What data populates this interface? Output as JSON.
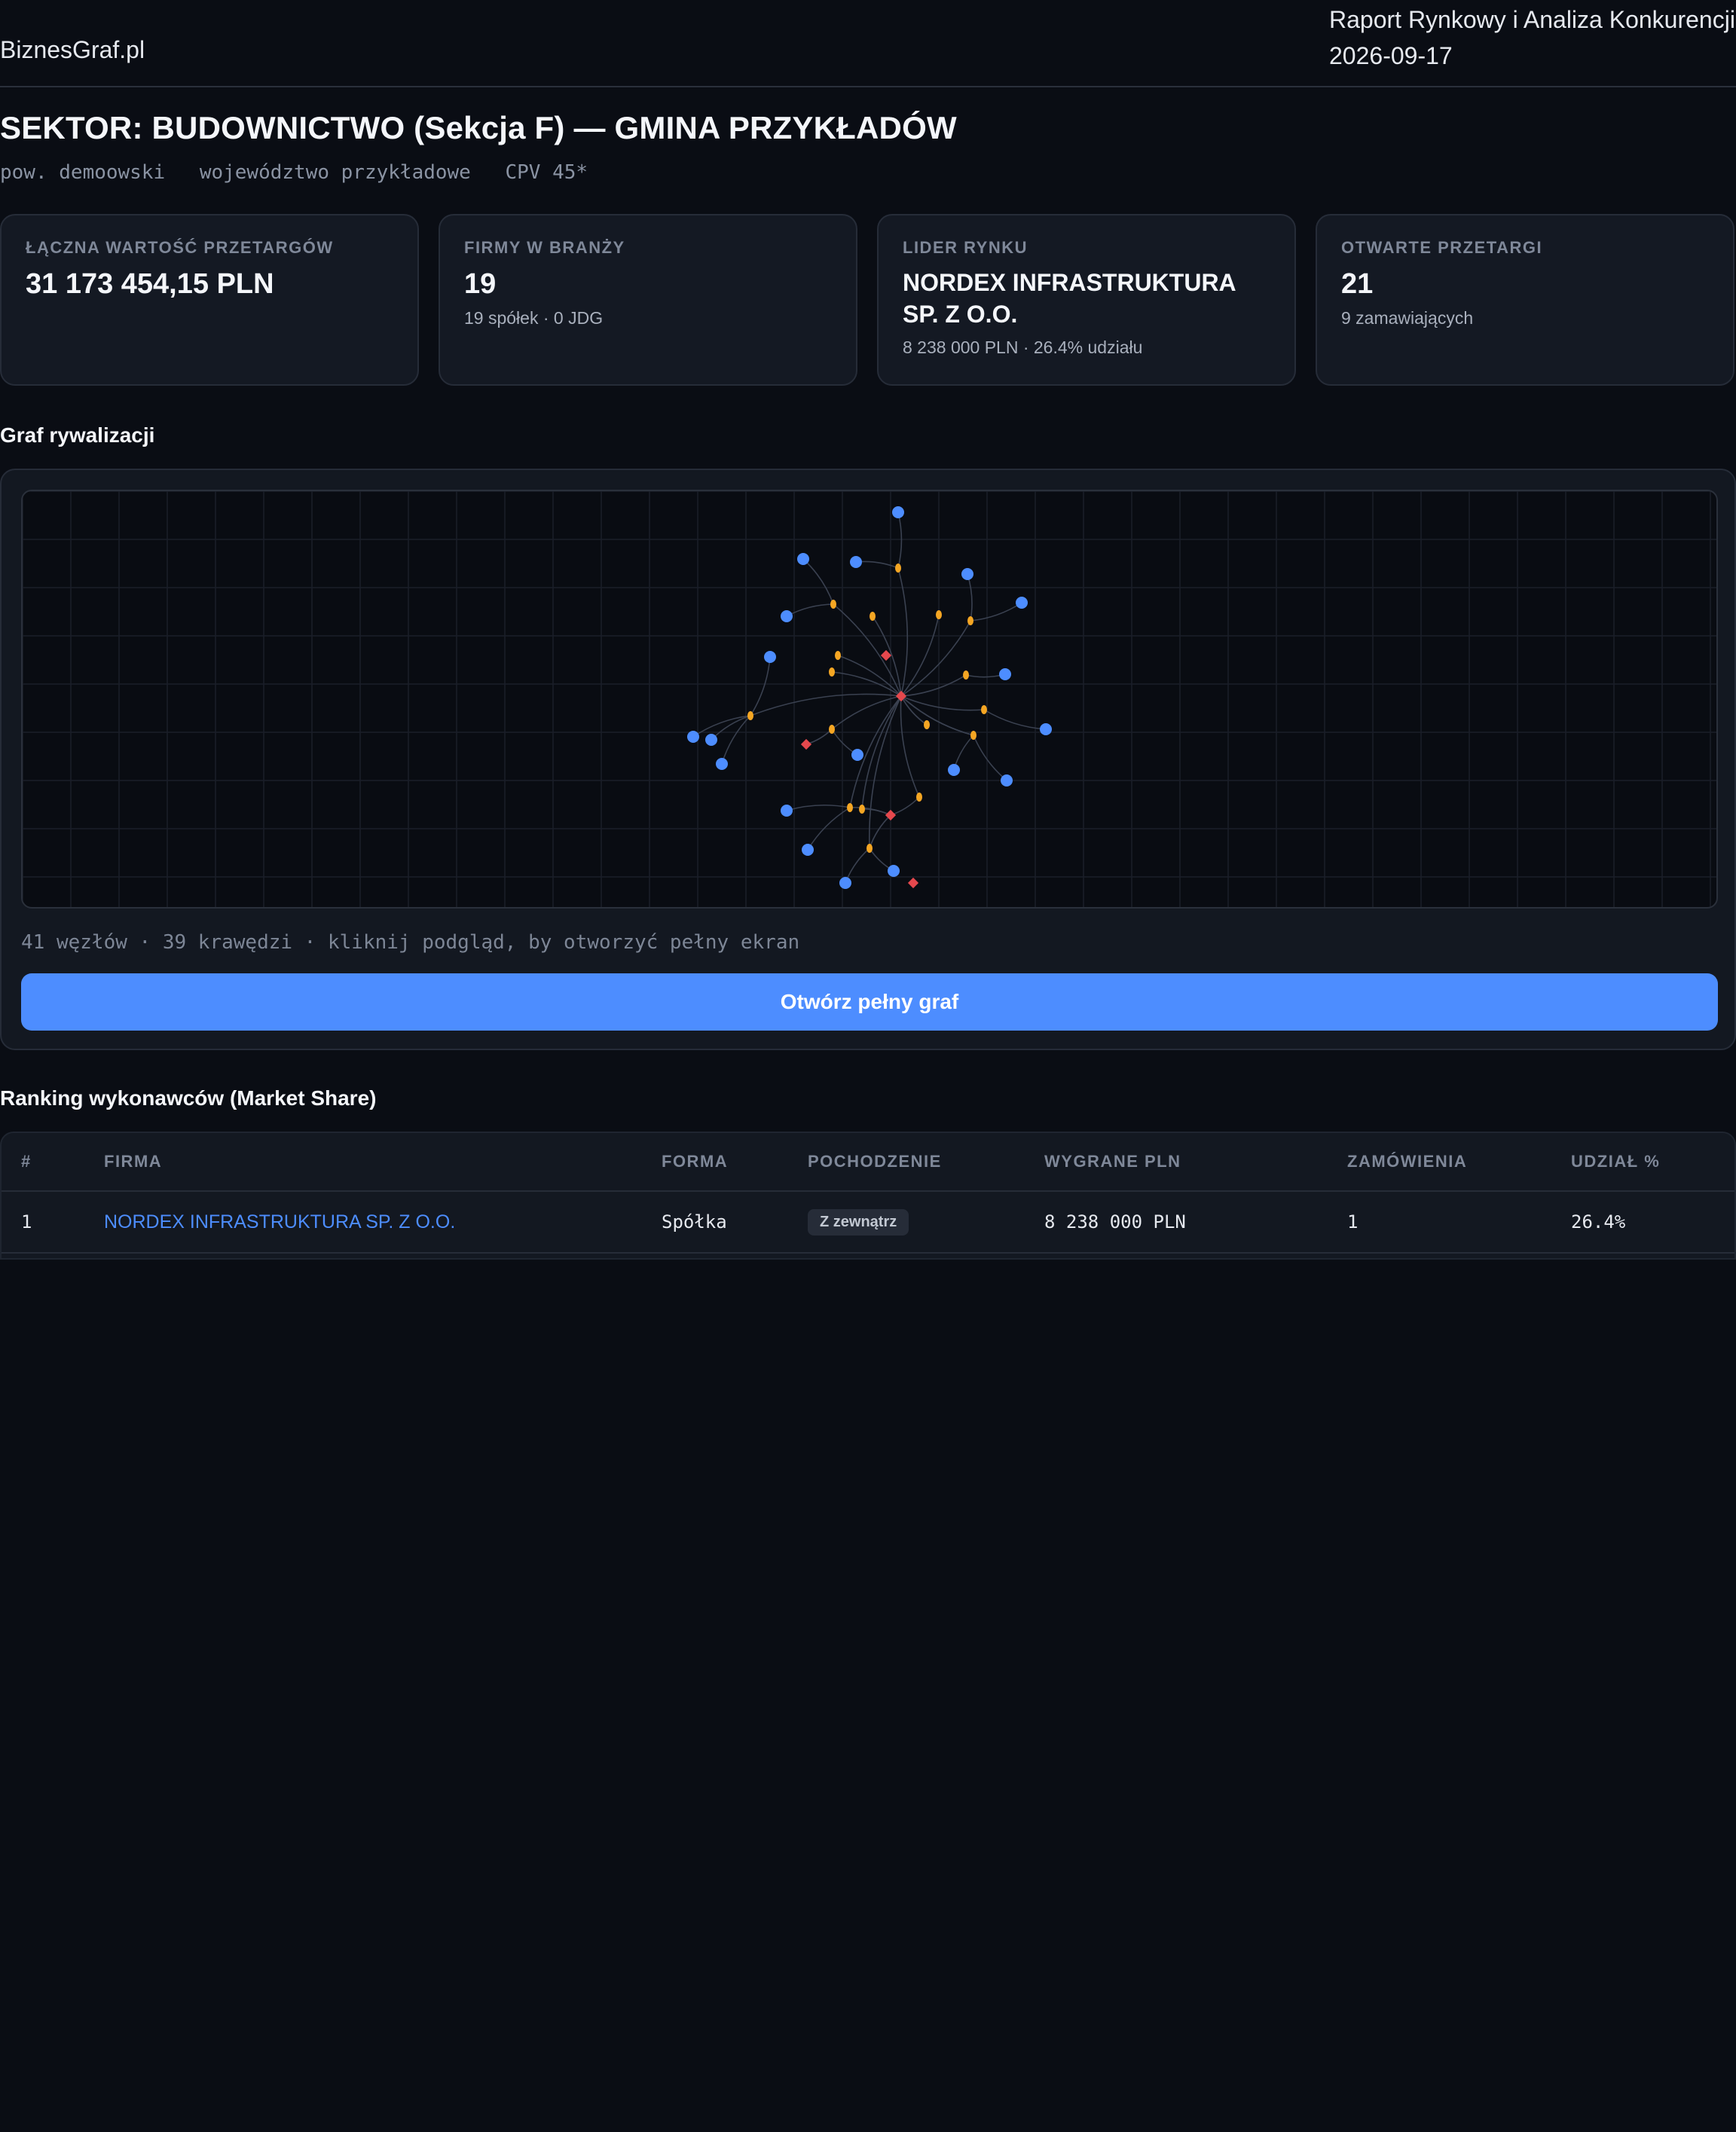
{
  "header": {
    "brand": "BiznesGraf.pl",
    "report_title": "Raport Rynkowy i Analiza Konkurencji",
    "report_date": "2026-09-17"
  },
  "page": {
    "title": "SEKTOR: BUDOWNICTWO (Sekcja F) — GMINA PRZYKŁADÓW",
    "tags": [
      "pow. demoowski",
      "województwo przykładowe",
      "CPV 45*"
    ]
  },
  "stats": [
    {
      "label": "ŁĄCZNA WARTOŚĆ PRZETARGÓW",
      "value": "31 173 454,15 PLN",
      "sub": ""
    },
    {
      "label": "FIRMY W BRANŻY",
      "value": "19",
      "sub": "19 spółek · 0 JDG"
    },
    {
      "label": "LIDER RYNKU",
      "value": "NORDEX INFRASTRUKTURA SP. Z O.O.",
      "sub": "8 238 000 PLN · 26.4% udziału"
    },
    {
      "label": "OTWARTE PRZETARGI",
      "value": "21",
      "sub": "9 zamawiających"
    }
  ],
  "graph": {
    "section_title": "Graf rywalizacji",
    "meta": "41 węzłów · 39 krawędzi · kliknij podgląd, by otworzyć pełny ekran",
    "open_button": "Otwórz pełny graf",
    "colors": {
      "company": "#4d8dff",
      "tender": "#f5a623",
      "buyer": "#e5484d",
      "edge": "#3a4150",
      "grid": "#1a1f29"
    }
  },
  "ranking": {
    "section_title": "Ranking wykonawców (Market Share)",
    "columns": [
      "#",
      "FIRMA",
      "FORMA",
      "POCHODZENIE",
      "WYGRANE PLN",
      "ZAMÓWIENIA",
      "UDZIAŁ %"
    ],
    "rows": [
      {
        "rank": "1",
        "firm": "NORDEX INFRASTRUKTURA SP. Z O.O.",
        "form": "Spółka",
        "origin": "Z zewnątrz",
        "won": "8 238 000 PLN",
        "orders": "1",
        "share": "26.4%"
      }
    ]
  }
}
